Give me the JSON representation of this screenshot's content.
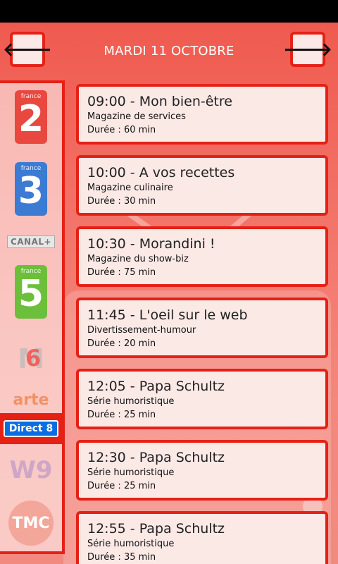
{
  "header": {
    "date": "MARDI 11 OCTOBRE",
    "prev_icon": "arrow-left-icon",
    "prev_glyph": "🡐",
    "next_icon": "arrow-right-icon",
    "next_glyph": "🡒"
  },
  "channels": [
    {
      "id": "france2",
      "label": "2",
      "sub": "france",
      "color": "#e8483e"
    },
    {
      "id": "france3",
      "label": "3",
      "sub": "france",
      "color": "#3b7bd4"
    },
    {
      "id": "canalplus",
      "label": "CANAL+"
    },
    {
      "id": "france5",
      "label": "5",
      "sub": "france",
      "color": "#6cbf3a"
    },
    {
      "id": "m6",
      "label": "M",
      "label2": "6"
    },
    {
      "id": "arte",
      "label": "arte"
    },
    {
      "id": "direct8",
      "label": "Direct 8",
      "selected": true
    },
    {
      "id": "w9",
      "label": "W9"
    },
    {
      "id": "tmc",
      "label": "TMC"
    }
  ],
  "programs": [
    {
      "time": "09:00",
      "title": "Mon bien-être",
      "genre": "Magazine de services",
      "duration": "Durée : 60 min"
    },
    {
      "time": "10:00",
      "title": "A vos recettes",
      "genre": "Magazine culinaire",
      "duration": "Durée : 30 min"
    },
    {
      "time": "10:30",
      "title": "Morandini !",
      "genre": "Magazine du show-biz",
      "duration": "Durée : 75 min"
    },
    {
      "time": "11:45",
      "title": "L'oeil sur le web",
      "genre": "Divertissement-humour",
      "duration": "Durée : 20 min"
    },
    {
      "time": "12:05",
      "title": "Papa Schultz",
      "genre": "Série humoristique",
      "duration": "Durée : 25 min"
    },
    {
      "time": "12:30",
      "title": "Papa Schultz",
      "genre": "Série humoristique",
      "duration": "Durée : 25 min"
    },
    {
      "time": "12:55",
      "title": "Papa Schultz",
      "genre": "Série humoristique",
      "duration": "Durée : 35 min"
    }
  ],
  "colors": {
    "accent": "#e52116",
    "card": "#fbe9e6"
  }
}
